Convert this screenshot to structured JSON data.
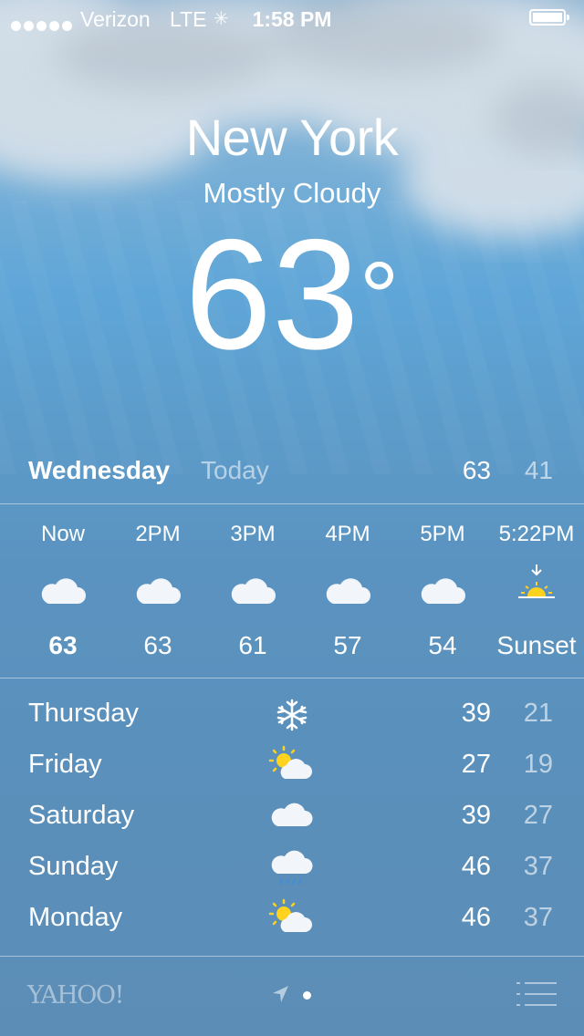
{
  "status_bar": {
    "signal_dots": 5,
    "carrier": "Verizon",
    "network": "LTE",
    "time": "1:58 PM",
    "battery_level": 1.0
  },
  "header": {
    "city": "New York",
    "condition": "Mostly Cloudy",
    "temperature": "63"
  },
  "today": {
    "day": "Wednesday",
    "label": "Today",
    "high": "63",
    "low": "41"
  },
  "hourly": [
    {
      "time": "Now",
      "icon": "cloud-icon",
      "value": "63"
    },
    {
      "time": "2PM",
      "icon": "cloud-icon",
      "value": "63"
    },
    {
      "time": "3PM",
      "icon": "cloud-icon",
      "value": "61"
    },
    {
      "time": "4PM",
      "icon": "cloud-icon",
      "value": "57"
    },
    {
      "time": "5PM",
      "icon": "cloud-icon",
      "value": "54"
    },
    {
      "time": "5:22PM",
      "icon": "sunset-icon",
      "value": "Sunset"
    }
  ],
  "daily": [
    {
      "day": "Thursday",
      "icon": "snowflake-icon",
      "high": "39",
      "low": "21"
    },
    {
      "day": "Friday",
      "icon": "partly-sunny-icon",
      "high": "27",
      "low": "19"
    },
    {
      "day": "Saturday",
      "icon": "cloud-icon",
      "high": "39",
      "low": "27"
    },
    {
      "day": "Sunday",
      "icon": "rain-icon",
      "high": "46",
      "low": "37"
    },
    {
      "day": "Monday",
      "icon": "partly-sunny-icon",
      "high": "46",
      "low": "37"
    }
  ],
  "footer": {
    "brand": "YAHOO!",
    "location_icon": "location-arrow-icon",
    "list_icon": "list-icon"
  },
  "colors": {
    "sun": "#ffd21e",
    "cloud": "#f2f6fa",
    "rain": "#3f8fd6"
  }
}
